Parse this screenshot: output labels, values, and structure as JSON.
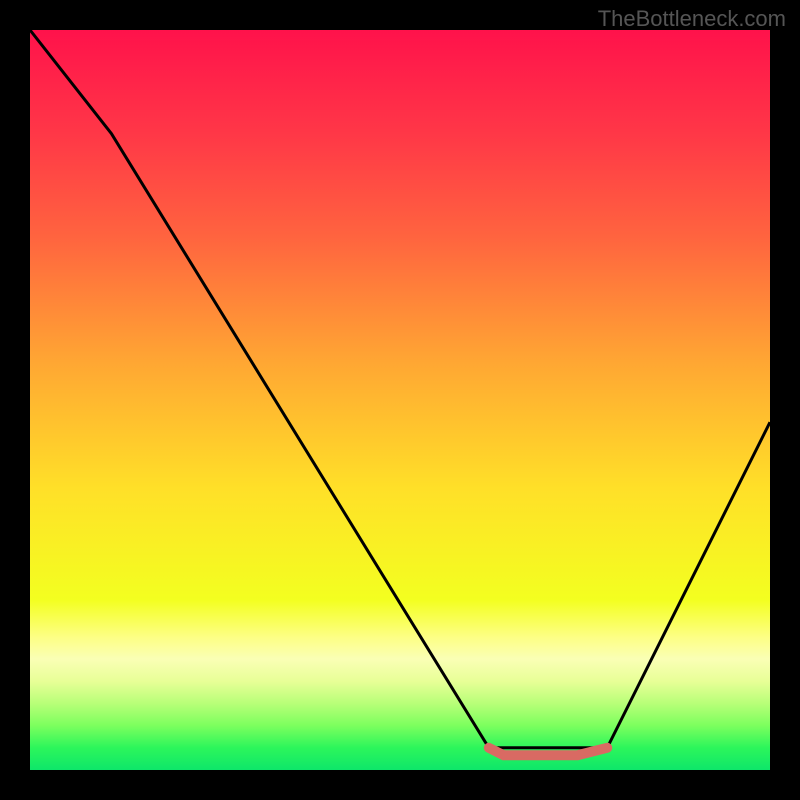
{
  "watermark": "TheBottleneck.com",
  "chart_data": {
    "type": "line",
    "title": "",
    "xlabel": "",
    "ylabel": "",
    "xlim": [
      0,
      100
    ],
    "ylim": [
      0,
      100
    ],
    "grid": false,
    "gradient_stops": [
      {
        "offset": 0,
        "color": "#ff124b"
      },
      {
        "offset": 14,
        "color": "#ff3747"
      },
      {
        "offset": 28,
        "color": "#ff643f"
      },
      {
        "offset": 45,
        "color": "#ffa733"
      },
      {
        "offset": 62,
        "color": "#ffe028"
      },
      {
        "offset": 77,
        "color": "#f3ff20"
      },
      {
        "offset": 82,
        "color": "#fdff84"
      },
      {
        "offset": 85,
        "color": "#faffb5"
      },
      {
        "offset": 88,
        "color": "#e8ff97"
      },
      {
        "offset": 91,
        "color": "#b8ff78"
      },
      {
        "offset": 94,
        "color": "#7cff5e"
      },
      {
        "offset": 97,
        "color": "#2cf65b"
      },
      {
        "offset": 100,
        "color": "#0ee66a"
      }
    ],
    "series": [
      {
        "name": "bottleneck-curve",
        "color": "#000000",
        "x": [
          0,
          11,
          62,
          70,
          78,
          100
        ],
        "values": [
          100,
          86,
          3,
          3,
          3,
          47
        ]
      }
    ],
    "trough_marker": {
      "color": "#d96a63",
      "x": [
        62,
        64,
        74,
        76,
        78
      ],
      "values": [
        3,
        2,
        2,
        2.5,
        3
      ]
    }
  }
}
